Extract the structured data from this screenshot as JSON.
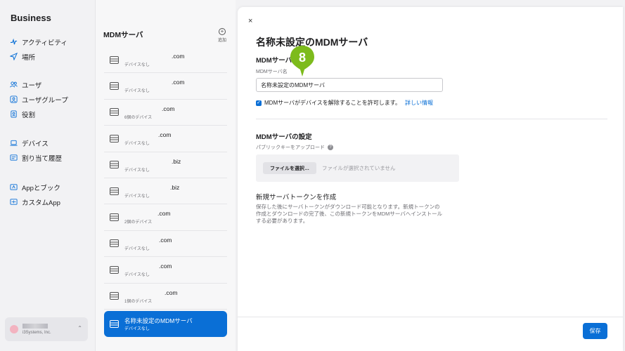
{
  "sidebar": {
    "brand": "Business",
    "groups": [
      [
        {
          "label": "アクティビティ",
          "icon": "activity-icon"
        },
        {
          "label": "場所",
          "icon": "location-arrow-icon"
        }
      ],
      [
        {
          "label": "ユーザ",
          "icon": "users-icon"
        },
        {
          "label": "ユーザグループ",
          "icon": "user-group-icon"
        },
        {
          "label": "役割",
          "icon": "role-badge-icon"
        }
      ],
      [
        {
          "label": "デバイス",
          "icon": "laptop-icon"
        },
        {
          "label": "割り当て履歴",
          "icon": "history-list-icon"
        }
      ],
      [
        {
          "label": "Appとブック",
          "icon": "app-book-icon"
        },
        {
          "label": "カスタムApp",
          "icon": "custom-app-icon"
        }
      ]
    ],
    "account": {
      "org": "i3Systems, Inc."
    }
  },
  "list": {
    "title": "MDMサーバ",
    "add_label": "追加",
    "items": [
      {
        "name": ".com",
        "sub": "デバイスなし"
      },
      {
        "name": ".com",
        "sub": "デバイスなし"
      },
      {
        "name": ".com",
        "sub": "6個のデバイス"
      },
      {
        "name": ".com",
        "sub": "デバイスなし"
      },
      {
        "name": ".biz",
        "sub": "デバイスなし"
      },
      {
        "name": ".biz",
        "sub": "デバイスなし"
      },
      {
        "name": ".com",
        "sub": "2個のデバイス"
      },
      {
        "name": ".com",
        "sub": "デバイスなし"
      },
      {
        "name": ".com",
        "sub": "デバイスなし"
      },
      {
        "name": ".com",
        "sub": "1個のデバイス"
      },
      {
        "name": "名称未設定のMDMサーバ",
        "sub": "デバイスなし",
        "selected": true
      }
    ]
  },
  "detail": {
    "close": "×",
    "title": "名称未設定のMDMサーバ",
    "section1_title": "MDMサーバ",
    "name_label": "MDMサーバ名",
    "name_value": "名称未設定のMDMサーバ",
    "checkbox_label": "MDMサーバがデバイスを解除することを許可します。",
    "checkbox_link": "詳しい情報",
    "section2_title": "MDMサーバの設定",
    "upload_label": "パブリックキーをアップロード",
    "help": "?",
    "file_button": "ファイルを選択…",
    "file_none": "ファイルが選択されていません",
    "token_title": "新規サーバトークンを作成",
    "token_desc": "保存した後にサーバトークンがダウンロード可能となります。新規トークンの作成とダウンロードの完了後、この新規トークンをMDMサーバへインストールする必要があります。",
    "save": "保存"
  },
  "step_marker": {
    "number": "8",
    "color": "#7dbb1c"
  }
}
